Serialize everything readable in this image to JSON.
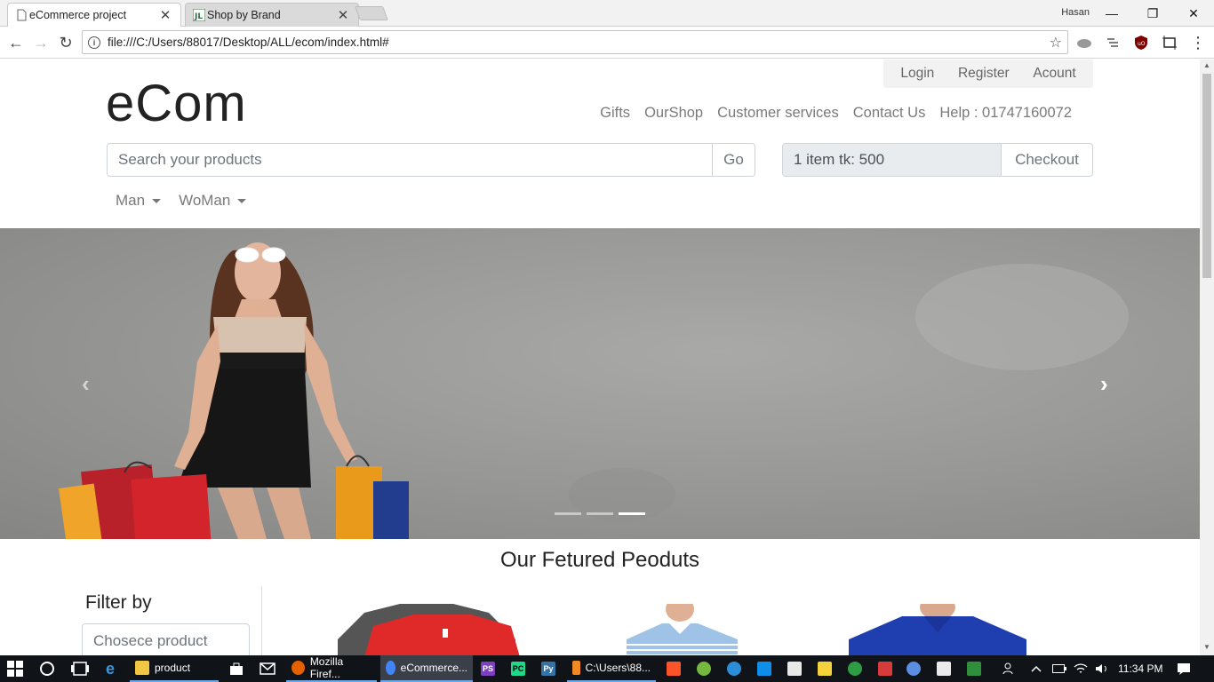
{
  "browser": {
    "tabs": [
      {
        "title": "eCommerce project",
        "active": true
      },
      {
        "title": "Shop by Brand",
        "active": false
      }
    ],
    "close_glyph": "✕",
    "user": "Hasan",
    "url": "file:///C:/Users/88017/Desktop/ALL/ecom/index.html#",
    "window_buttons": {
      "minimize": "—",
      "restore": "❐",
      "close": "✕"
    },
    "nav": {
      "back": "←",
      "forward": "→",
      "reload": "↻"
    },
    "bookmark_star": "☆",
    "menu_glyph": "⋮"
  },
  "site": {
    "brand": "eCom",
    "top_links": [
      "Login",
      "Register",
      "Acount"
    ],
    "nav": [
      "Gifts",
      "OurShop",
      "Customer services",
      "Contact Us",
      "Help : 01747160072"
    ],
    "search": {
      "placeholder": "Search your products",
      "button": "Go"
    },
    "cart": {
      "summary": "1 item tk: 500",
      "checkout": "Checkout"
    },
    "categories": [
      "Man",
      "WoMan"
    ],
    "carousel": {
      "prev": "‹",
      "next": "›",
      "slides": 3,
      "active_slide": 3
    },
    "featured_title": "Our Fetured Peoduts",
    "filter": {
      "title": "Filter by",
      "select_placeholder": "Chosece product"
    }
  },
  "taskbar": {
    "apps": [
      {
        "label": "product",
        "color": "#f2c744"
      },
      {
        "label": "Mozilla Firef...",
        "color": "#e66000"
      },
      {
        "label": "eCommerce...",
        "color": "#4285f4"
      },
      {
        "label": "C:\\Users\\88...",
        "color": "#f08a24"
      }
    ],
    "time": "11:34 PM"
  },
  "colors": {
    "accent": "#007bff",
    "nav_text": "#7a7a7a",
    "taskbar": "#101318"
  }
}
